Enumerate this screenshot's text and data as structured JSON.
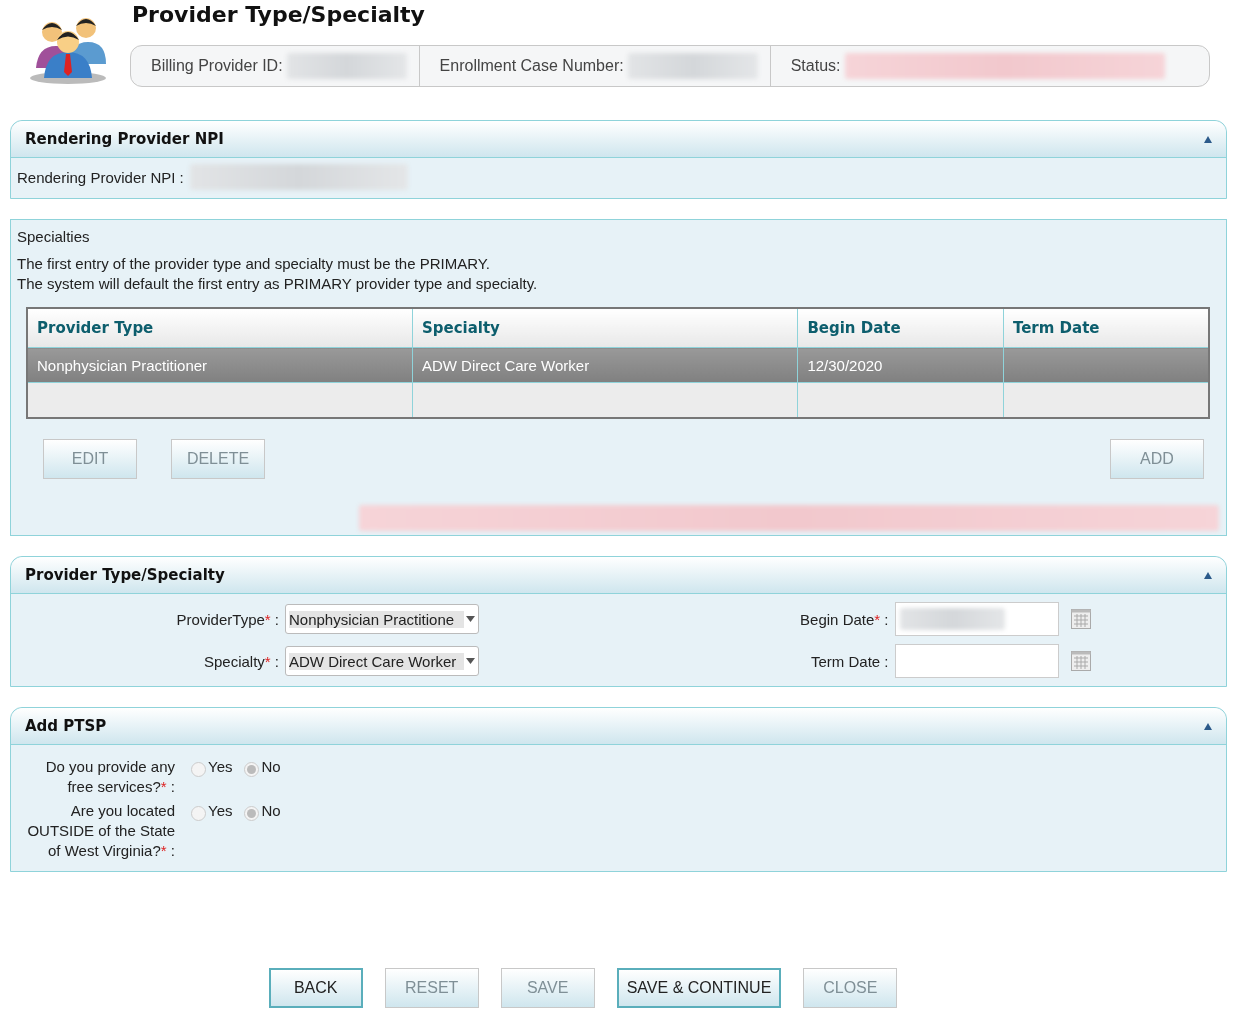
{
  "header": {
    "title": "Provider Type/Specialty",
    "info": [
      {
        "label": "Billing Provider ID:",
        "redacted": true
      },
      {
        "label": "Enrollment Case Number:",
        "redacted": true
      },
      {
        "label": "Status:",
        "redacted": true
      }
    ]
  },
  "npi_panel": {
    "title": "Rendering Provider NPI",
    "expanded": true,
    "label": "Rendering Provider NPI :",
    "redacted": true
  },
  "specialties": {
    "heading": "Specialties",
    "notes": [
      "The first entry of the provider type and specialty must be the PRIMARY.",
      "The system will default the first entry as PRIMARY provider type and specialty."
    ],
    "table": {
      "columns": [
        "Provider Type",
        "Specialty",
        "Begin Date",
        "Term Date"
      ],
      "rows": [
        {
          "cells": [
            "Nonphysician Practitioner",
            "ADW Direct Care Worker",
            "12/30/2020",
            ""
          ],
          "selected": true
        },
        {
          "cells": [
            "",
            "",
            "",
            ""
          ],
          "selected": false
        }
      ]
    },
    "left_buttons": [
      {
        "label": "EDIT",
        "disabled": true
      },
      {
        "label": "DELETE",
        "disabled": true
      }
    ],
    "right_buttons": [
      {
        "label": "ADD",
        "disabled": true
      }
    ],
    "message_redacted": true
  },
  "form_panel": {
    "title": "Provider Type/Specialty",
    "expanded": true,
    "left": [
      {
        "label": "ProviderType",
        "required_mark": "*",
        "colon": ":",
        "kind": "select",
        "value": "Nonphysician Practitione"
      },
      {
        "label": "Specialty",
        "required_mark": "*",
        "colon": ":",
        "kind": "select",
        "value": "ADW Direct Care Worker"
      }
    ],
    "right": [
      {
        "label": "Begin Date",
        "required_mark": "*",
        "colon": ":",
        "kind": "date",
        "redacted": true
      },
      {
        "label": "Term Date",
        "colon": ":",
        "kind": "date",
        "redacted": false
      }
    ]
  },
  "ptsp_panel": {
    "title": "Add PTSP",
    "expanded": true,
    "questions": [
      {
        "label": "Do you provide any free services?",
        "required_mark": "*",
        "colon": ":",
        "options": [
          {
            "label": "Yes",
            "selected": false
          },
          {
            "label": "No",
            "selected": true
          }
        ]
      },
      {
        "label": "Are you located OUTSIDE of the State of West Virginia?",
        "required_mark": "*",
        "colon": ":",
        "options": [
          {
            "label": "Yes",
            "selected": false
          },
          {
            "label": "No",
            "selected": true
          }
        ]
      }
    ]
  },
  "footer_buttons": [
    {
      "label": "BACK",
      "disabled": false
    },
    {
      "label": "RESET",
      "disabled": true
    },
    {
      "label": "SAVE",
      "disabled": true
    },
    {
      "label": "SAVE & CONTINUE",
      "disabled": false
    },
    {
      "label": "CLOSE",
      "disabled": true
    }
  ]
}
